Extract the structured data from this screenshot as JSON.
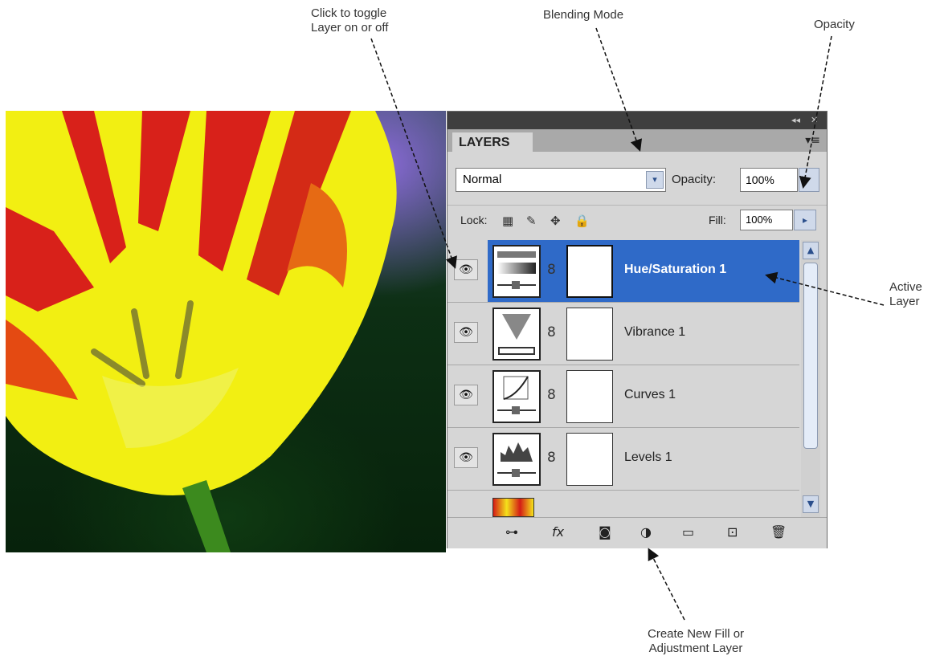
{
  "annotations": {
    "toggle": "Click to toggle\nLayer on or off",
    "blend": "Blending Mode",
    "opacity": "Opacity",
    "active": "Active\nLayer",
    "create": "Create New Fill or\nAdjustment Layer"
  },
  "panel": {
    "titlebar_collapse": "◂◂",
    "titlebar_close": "✕",
    "tab_label": "LAYERS",
    "menu_icon": "▾≡",
    "blend_mode_value": "Normal",
    "opacity_label": "Opacity:",
    "opacity_value": "100%",
    "lock_label": "Lock:",
    "fill_label": "Fill:",
    "fill_value": "100%"
  },
  "layers": [
    {
      "name": "Hue/Saturation 1",
      "active": true,
      "thumb_icon": "hue-saturation-icon"
    },
    {
      "name": "Vibrance 1",
      "active": false,
      "thumb_icon": "vibrance-icon"
    },
    {
      "name": "Curves 1",
      "active": false,
      "thumb_icon": "curves-icon"
    },
    {
      "name": "Levels 1",
      "active": false,
      "thumb_icon": "levels-icon"
    }
  ],
  "icons": {
    "eye": "👁",
    "chain": "8",
    "lock_transparent": "▦",
    "lock_image": "✎",
    "lock_position": "✥",
    "lock_all": "🔒",
    "link_layers": "⊶",
    "fx": "fx",
    "add_mask": "◙",
    "new_adjustment": "◑",
    "new_group": "▭",
    "new_layer": "⊡",
    "delete": "🗑",
    "scroll_up": "▲",
    "scroll_down": "▼",
    "fill_arrow": "▸",
    "blend_arrow": "▾"
  },
  "colors": {
    "active_layer": "#2f6ac8",
    "panel_bg": "#d6d6d6",
    "titlebar": "#3f3f3f"
  }
}
